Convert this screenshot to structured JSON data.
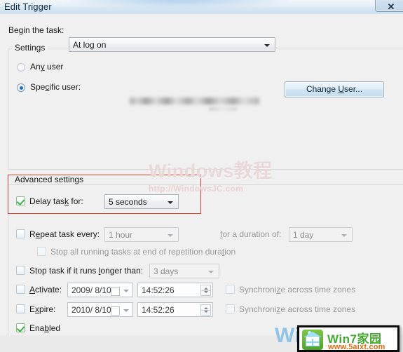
{
  "window": {
    "title": "Edit Trigger",
    "close_label": "✕"
  },
  "begin": {
    "label": "Begin the task:",
    "value": "At log on"
  },
  "settings_group": {
    "title": "Settings",
    "any_user_label": "Any user",
    "specific_user_label": "Specific user:",
    "specific_user_value": "",
    "change_user_button": "Change User..."
  },
  "advanced_group": {
    "title": "Advanced settings",
    "delay_task": {
      "label": "Delay task for:",
      "value": "5 seconds"
    },
    "repeat_task": {
      "label": "Repeat task every:",
      "value": "1 hour",
      "duration_label": "for a duration of:",
      "duration_value": "1 day"
    },
    "stop_all_running": {
      "label": "Stop all running tasks at end of repetition duration"
    },
    "stop_task_longer": {
      "label": "Stop task if it runs longer than:",
      "value": "3 days"
    },
    "activate": {
      "label": "Activate:",
      "date": "2009/ 8/10",
      "time": "14:52:26",
      "sync_label": "Synchronize across time zones"
    },
    "expire": {
      "label": "Expire:",
      "date": "2010/ 8/10",
      "time": "14:52:26",
      "sync_label": "Synchronize across time zones"
    },
    "enabled": {
      "label": "Enabled"
    }
  },
  "watermarks": {
    "center_title": "Windows教程",
    "center_url": "http://WindowsJC.com",
    "bottom_blue": "Win",
    "logo_name": "Win7家园",
    "logo_url": "www.5aixt.com"
  },
  "colors": {
    "annotation_red": "#e0402f",
    "check_green": "#3cb54a",
    "radio_blue": "#1a6fc4"
  }
}
